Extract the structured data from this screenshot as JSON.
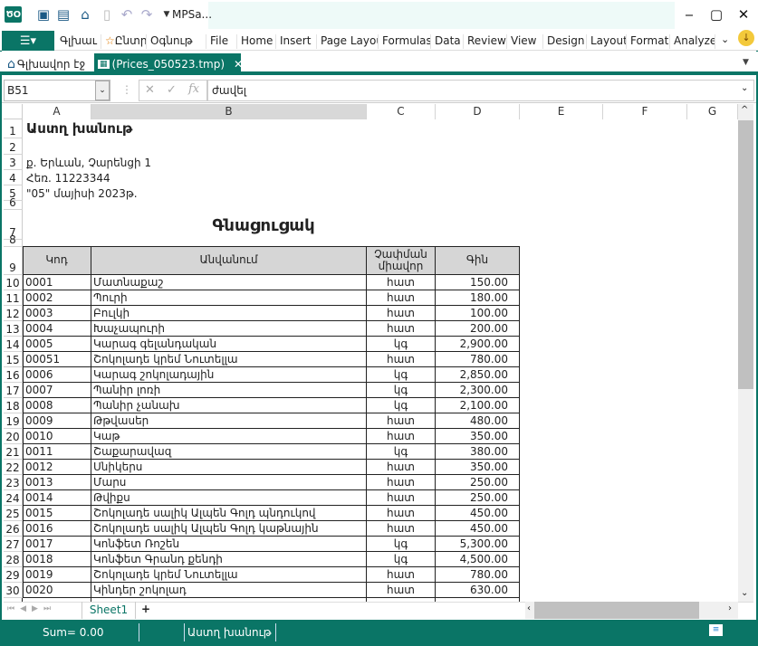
{
  "window": {
    "title": "MPSa...",
    "accent": "#0a7566",
    "minimize": "‒",
    "maximize": "▢",
    "close": "✕"
  },
  "ribbon": {
    "file_icon": "menu-icon",
    "tabs": [
      "Գլխաւ",
      "Ընտրյլ",
      "Օգնութ",
      "File",
      "Home",
      "Insert",
      "Page Layou",
      "Formulas",
      "Data",
      "Review",
      "View",
      "Design",
      "Layout",
      "Format",
      "Analyze"
    ]
  },
  "doc_tabs": [
    {
      "label": "Գլխավոր էջ",
      "icon": "home-icon",
      "active": false
    },
    {
      "label": "(Prices_050523.tmp)",
      "icon": "spreadsheet-icon",
      "active": true
    }
  ],
  "formula_bar": {
    "name_box": "B51",
    "formula": "ժավել"
  },
  "columns": [
    "A",
    "B",
    "C",
    "D",
    "E",
    "F",
    "G"
  ],
  "sheet": {
    "company": "Աստղ խանութ",
    "address": "ք. Երևան, Չարենցի 1",
    "phone": "Հեռ. 11223344",
    "date": "\"05\" մայիսի 2023թ.",
    "title": "Գնացուցակ",
    "headers": [
      "Կոդ",
      "Անվանում",
      "Չափման միավոր",
      "Գին"
    ],
    "rows": [
      [
        "0001",
        "Մատնաքաշ",
        "հատ",
        "150.00"
      ],
      [
        "0002",
        "Պուրի",
        "հատ",
        "180.00"
      ],
      [
        "0003",
        "Բուլկի",
        "հատ",
        "100.00"
      ],
      [
        "0004",
        "Խաչապուրի",
        "հատ",
        "200.00"
      ],
      [
        "0005",
        "Կարագ գելանդական",
        "կգ",
        "2,900.00"
      ],
      [
        "00051",
        "Շոկոլադե կրեմ Նուտելլա",
        "հատ",
        "780.00"
      ],
      [
        "0006",
        "Կարագ շոկոլադային",
        "կգ",
        "2,850.00"
      ],
      [
        "0007",
        "Պանիր լոռի",
        "կգ",
        "2,300.00"
      ],
      [
        "0008",
        "Պանիր չանախ",
        "կգ",
        "2,100.00"
      ],
      [
        "0009",
        "Թթվասեր",
        "հատ",
        "480.00"
      ],
      [
        "0010",
        "Կաթ",
        "հատ",
        "350.00"
      ],
      [
        "0011",
        "Շաքարավազ",
        "կգ",
        "380.00"
      ],
      [
        "0012",
        "Սնիկերս",
        "հատ",
        "350.00"
      ],
      [
        "0013",
        "Մարս",
        "հատ",
        "250.00"
      ],
      [
        "0014",
        "Թվիքս",
        "հատ",
        "250.00"
      ],
      [
        "0015",
        "Շոկոլադե սալիկ Ալպեն Գոլդ պնդուկով",
        "հատ",
        "450.00"
      ],
      [
        "0016",
        "Շոկոլադե սալիկ Ալպեն Գոլդ կաթնային",
        "հատ",
        "450.00"
      ],
      [
        "0017",
        "Կոնֆետ Ռոշեն",
        "կգ",
        "5,300.00"
      ],
      [
        "0018",
        "Կոնֆետ Գրանդ քենդի",
        "կգ",
        "4,500.00"
      ],
      [
        "0019",
        "Շոկոլադե կրեմ Նուտելլա",
        "հատ",
        "780.00"
      ],
      [
        "0020",
        "Կինդեր շոկոլադ",
        "հատ",
        "630.00"
      ]
    ]
  },
  "sheet_tabs": {
    "active": "Sheet1",
    "add": "+"
  },
  "status": {
    "sum": "Sum= 0.00",
    "company": "Աստղ խանութ",
    "comment_icon": "comment-icon"
  }
}
